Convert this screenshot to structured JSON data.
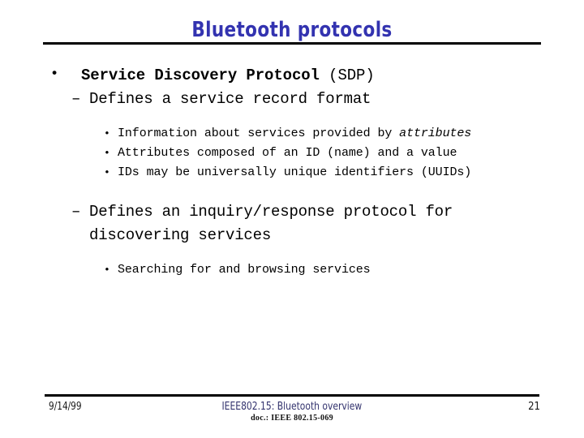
{
  "slide": {
    "title": "Bluetooth protocols",
    "title_color": "#3333b0",
    "rule_color": "#000000"
  },
  "content": {
    "level1": {
      "bullet_glyph": "•",
      "bold_text": "Service Discovery Protocol ",
      "light_text": "(SDP)"
    },
    "groups": [
      {
        "level2": {
          "bullet_glyph": "–",
          "text": "Defines a service record format"
        },
        "level3": [
          {
            "bullet_glyph": "•",
            "text_before": "Information about services provided by ",
            "emphasis": "attributes",
            "text_after": ""
          },
          {
            "bullet_glyph": "•",
            "text_before": "Attributes composed of an ID (name) and a value",
            "emphasis": "",
            "text_after": ""
          },
          {
            "bullet_glyph": "•",
            "text_before": "IDs may be universally unique identifiers (UUIDs)",
            "emphasis": "",
            "text_after": ""
          }
        ]
      },
      {
        "level2": {
          "bullet_glyph": "–",
          "text": "Defines an inquiry/response protocol for discovering services"
        },
        "level3": [
          {
            "bullet_glyph": "•",
            "text_before": "Searching for and browsing services",
            "emphasis": "",
            "text_after": ""
          }
        ]
      }
    ]
  },
  "footer": {
    "date": "9/14/99",
    "center": "IEEE802.15: Bluetooth overview",
    "page_number": "21",
    "doc_line": "doc.: IEEE 802.15-069",
    "center_color": "#33336e"
  }
}
